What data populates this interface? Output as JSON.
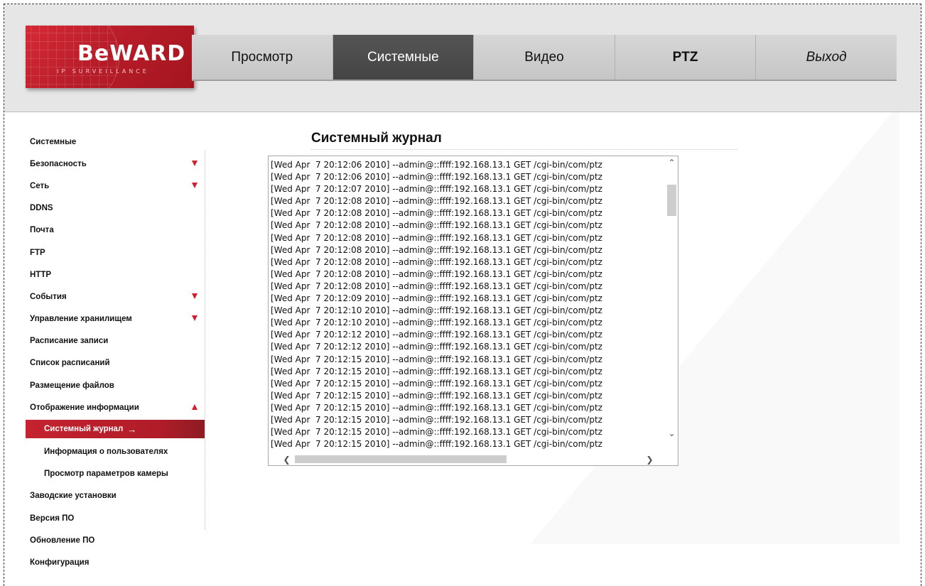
{
  "logo": {
    "text": "BeWARD",
    "subtitle": "IP SURVEILLANCE"
  },
  "nav": {
    "items": [
      {
        "label": "Просмотр",
        "active": false
      },
      {
        "label": "Системные",
        "active": true
      },
      {
        "label": "Видео",
        "active": false
      },
      {
        "label": "PTZ",
        "active": false
      },
      {
        "label": "Выход",
        "active": false
      }
    ]
  },
  "sidebar": {
    "items": [
      {
        "label": "Системные",
        "arrow": "none",
        "sub": false
      },
      {
        "label": "Безопасность",
        "arrow": "down",
        "sub": false
      },
      {
        "label": "Сеть",
        "arrow": "down",
        "sub": false
      },
      {
        "label": "DDNS",
        "arrow": "none",
        "sub": false
      },
      {
        "label": "Почта",
        "arrow": "none",
        "sub": false
      },
      {
        "label": "FTP",
        "arrow": "none",
        "sub": false
      },
      {
        "label": "HTTP",
        "arrow": "none",
        "sub": false
      },
      {
        "label": "События",
        "arrow": "down",
        "sub": false
      },
      {
        "label": "Управление хранилищем",
        "arrow": "down",
        "sub": false
      },
      {
        "label": "Расписание записи",
        "arrow": "none",
        "sub": false
      },
      {
        "label": "Список расписаний",
        "arrow": "none",
        "sub": false
      },
      {
        "label": "Размещение файлов",
        "arrow": "none",
        "sub": false
      },
      {
        "label": "Отображение информации",
        "arrow": "up",
        "sub": false
      },
      {
        "label": "Системный журнал",
        "arrow": "none",
        "sub": true,
        "active": true
      },
      {
        "label": "Информация о пользователях",
        "arrow": "none",
        "sub": true
      },
      {
        "label": "Просмотр параметров камеры",
        "arrow": "none",
        "sub": true
      },
      {
        "label": "Заводские установки",
        "arrow": "none",
        "sub": false
      },
      {
        "label": "Версия ПО",
        "arrow": "none",
        "sub": false
      },
      {
        "label": "Обновление ПО",
        "arrow": "none",
        "sub": false
      },
      {
        "label": "Конфигурация",
        "arrow": "none",
        "sub": false
      }
    ],
    "active_arrow": "→"
  },
  "main": {
    "title": "Системный журнал",
    "log_lines": [
      "[Wed Apr  7 20:12:06 2010] --admin@::ffff:192.168.13.1 GET /cgi-bin/com/ptz",
      "[Wed Apr  7 20:12:06 2010] --admin@::ffff:192.168.13.1 GET /cgi-bin/com/ptz",
      "[Wed Apr  7 20:12:07 2010] --admin@::ffff:192.168.13.1 GET /cgi-bin/com/ptz",
      "[Wed Apr  7 20:12:08 2010] --admin@::ffff:192.168.13.1 GET /cgi-bin/com/ptz",
      "[Wed Apr  7 20:12:08 2010] --admin@::ffff:192.168.13.1 GET /cgi-bin/com/ptz",
      "[Wed Apr  7 20:12:08 2010] --admin@::ffff:192.168.13.1 GET /cgi-bin/com/ptz",
      "[Wed Apr  7 20:12:08 2010] --admin@::ffff:192.168.13.1 GET /cgi-bin/com/ptz",
      "[Wed Apr  7 20:12:08 2010] --admin@::ffff:192.168.13.1 GET /cgi-bin/com/ptz",
      "[Wed Apr  7 20:12:08 2010] --admin@::ffff:192.168.13.1 GET /cgi-bin/com/ptz",
      "[Wed Apr  7 20:12:08 2010] --admin@::ffff:192.168.13.1 GET /cgi-bin/com/ptz",
      "[Wed Apr  7 20:12:08 2010] --admin@::ffff:192.168.13.1 GET /cgi-bin/com/ptz",
      "[Wed Apr  7 20:12:09 2010] --admin@::ffff:192.168.13.1 GET /cgi-bin/com/ptz",
      "[Wed Apr  7 20:12:10 2010] --admin@::ffff:192.168.13.1 GET /cgi-bin/com/ptz",
      "[Wed Apr  7 20:12:10 2010] --admin@::ffff:192.168.13.1 GET /cgi-bin/com/ptz",
      "[Wed Apr  7 20:12:12 2010] --admin@::ffff:192.168.13.1 GET /cgi-bin/com/ptz",
      "[Wed Apr  7 20:12:12 2010] --admin@::ffff:192.168.13.1 GET /cgi-bin/com/ptz",
      "[Wed Apr  7 20:12:15 2010] --admin@::ffff:192.168.13.1 GET /cgi-bin/com/ptz",
      "[Wed Apr  7 20:12:15 2010] --admin@::ffff:192.168.13.1 GET /cgi-bin/com/ptz",
      "[Wed Apr  7 20:12:15 2010] --admin@::ffff:192.168.13.1 GET /cgi-bin/com/ptz",
      "[Wed Apr  7 20:12:15 2010] --admin@::ffff:192.168.13.1 GET /cgi-bin/com/ptz",
      "[Wed Apr  7 20:12:15 2010] --admin@::ffff:192.168.13.1 GET /cgi-bin/com/ptz",
      "[Wed Apr  7 20:12:15 2010] --admin@::ffff:192.168.13.1 GET /cgi-bin/com/ptz",
      "[Wed Apr  7 20:12:15 2010] --admin@::ffff:192.168.13.1 GET /cgi-bin/com/ptz",
      "[Wed Apr  7 20:12:15 2010] --admin@::ffff:192.168.13.1 GET /cgi-bin/com/ptz"
    ]
  },
  "icons": {
    "scroll_up": "chevron-up-icon",
    "scroll_down": "chevron-down-icon",
    "scroll_left": "chevron-left-icon",
    "scroll_right": "chevron-right-icon",
    "expand": "triangle-down-icon",
    "collapse": "triangle-up-icon"
  },
  "colors": {
    "brand_red": "#c4232f",
    "nav_active": "#4a4a4a",
    "arrow_red": "#d21f2f"
  }
}
